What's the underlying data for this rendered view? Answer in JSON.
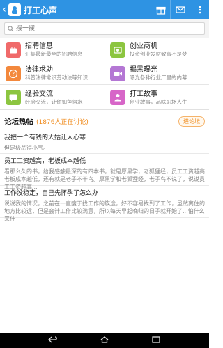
{
  "app": {
    "title": "打工心声"
  },
  "search": {
    "placeholder": "搜一搜"
  },
  "menu": [
    {
      "title": "招聘信息",
      "subtitle": "汇集最新最全的招聘信息",
      "icon": "briefcase-icon",
      "color": "#f06a6a"
    },
    {
      "title": "创业商机",
      "subtitle": "投资创业发财致富不是梦",
      "icon": "money-icon",
      "color": "#8cc540"
    },
    {
      "title": "法律求助",
      "subtitle": "科普法律常识劳动法等知识",
      "icon": "question-icon",
      "color": "#f3883c"
    },
    {
      "title": "揭黑曝光",
      "subtitle": "曝光各种行业厂里的内幕",
      "icon": "camera-icon",
      "color": "#b477d4"
    },
    {
      "title": "经验交流",
      "subtitle": "经验交流，让你如鱼得水",
      "icon": "chat-icon",
      "color": "#8cc540"
    },
    {
      "title": "打工故事",
      "subtitle": "创业故事，品味职场人生",
      "icon": "person-icon",
      "color": "#d766c8"
    }
  ],
  "forum": {
    "heading": "论坛热帖",
    "online": "(1876人正在讨论)",
    "enter_label": "进论坛"
  },
  "posts": [
    {
      "title": "我把一个有钱的大姑让人心寒",
      "excerpt": "但是极品得小气。"
    },
    {
      "title": "员工工资越高，老板成本越低",
      "excerpt": "看那么久的书，给我感触最深的有四本书，就是厚黑学，老狐狸经，员工工资越高老板成本越低，还有就是老子不干鸟。厚黑学和老狐狸经，老子鸟不说了，说说员工工资越高..."
    },
    {
      "title": "工作没稳定，自己先怀孕了怎么办",
      "excerpt": "说说我的情况，之前在一直瘦于找工作的族途，好不容易找到了工作，虽然离住的地方比较远，但是会计工作比较满意，所以每天早起晚归的日子就开始了...怕什么来什"
    }
  ]
}
